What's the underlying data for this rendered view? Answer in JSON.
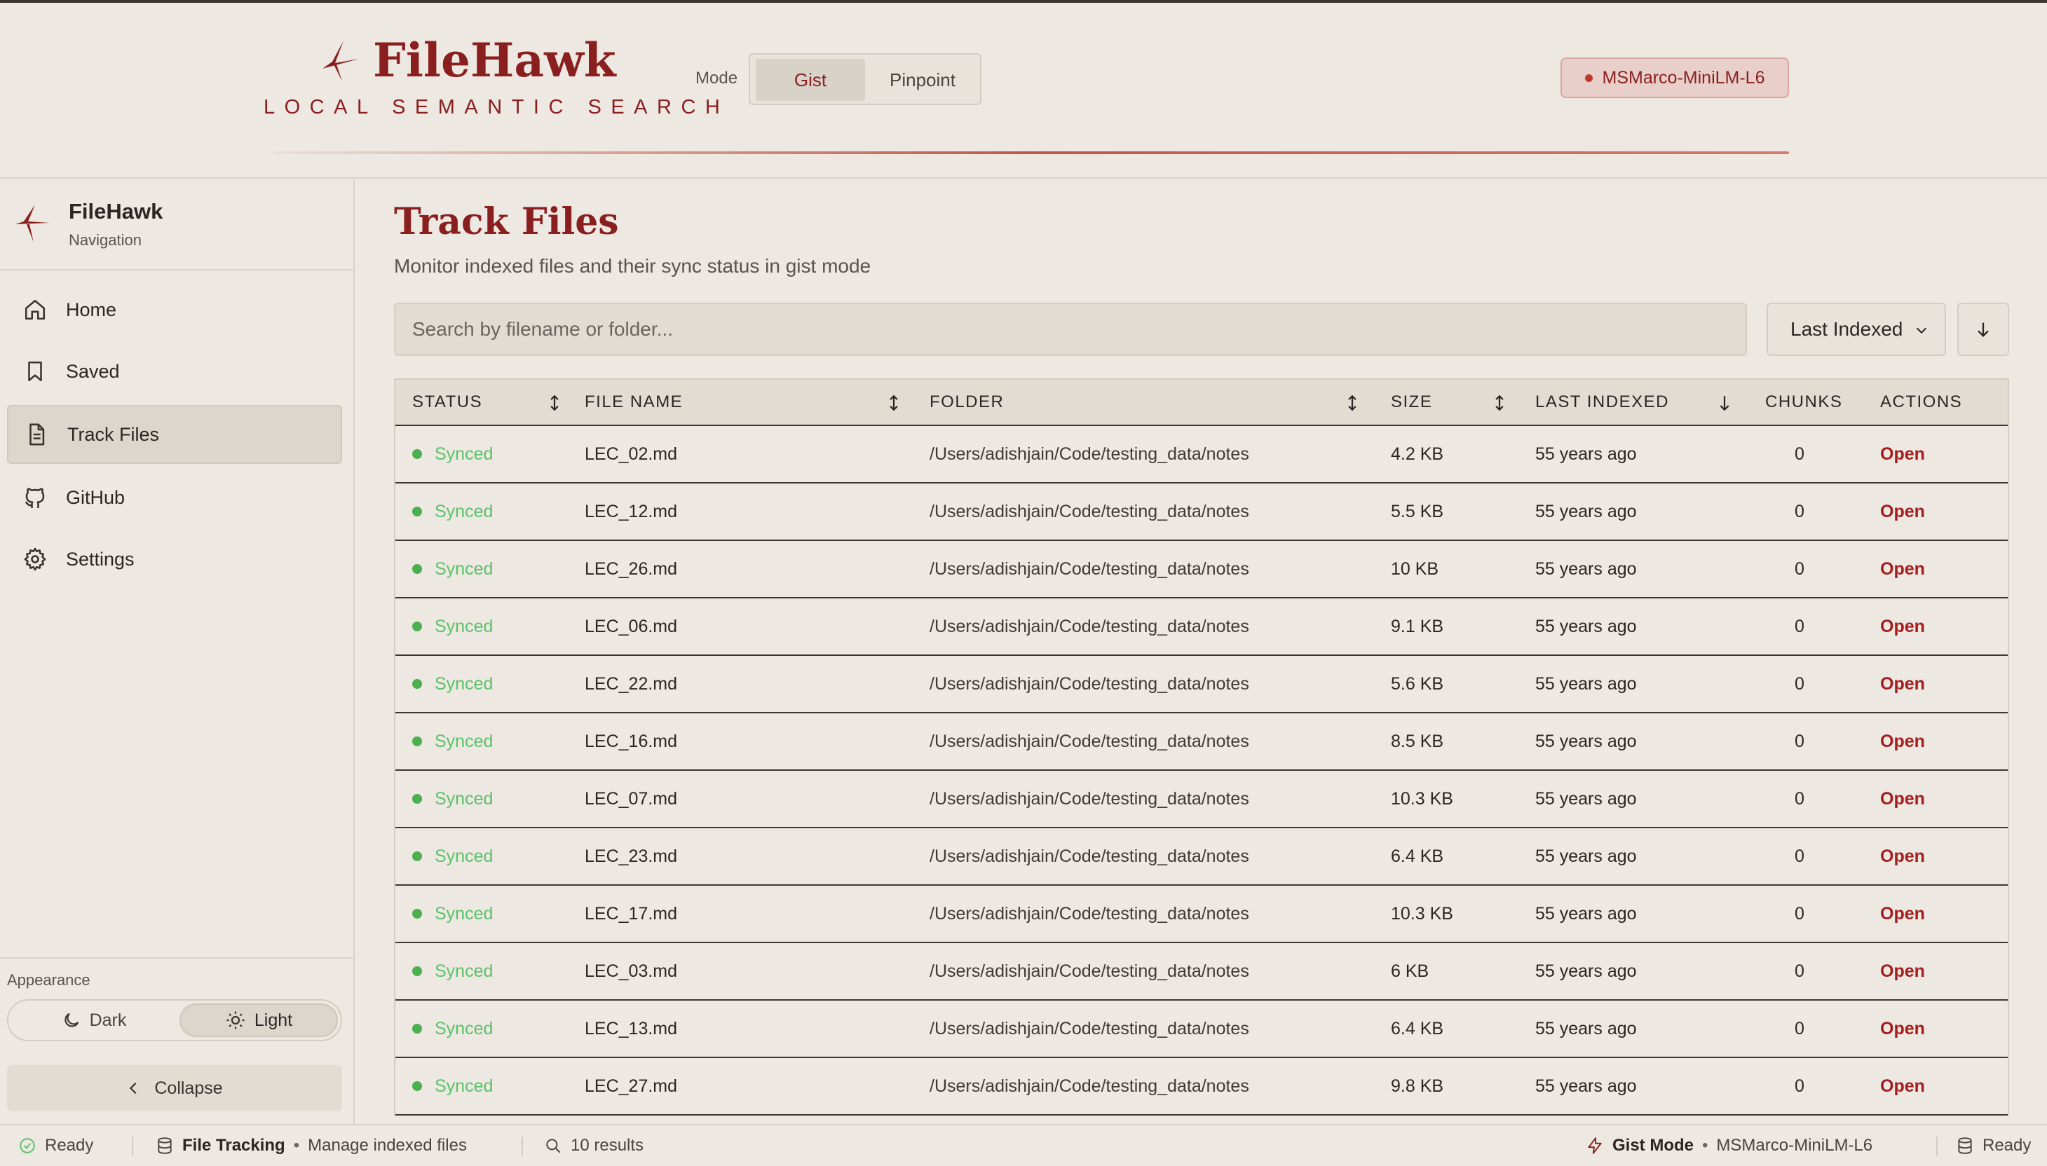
{
  "header": {
    "brand": "FileHawk",
    "tagline": "LOCAL SEMANTIC SEARCH",
    "mode_label": "Mode",
    "modes": [
      "Gist",
      "Pinpoint"
    ],
    "active_mode": "Gist",
    "model_badge": "MSMarco-MiniLM-L6"
  },
  "sidebar": {
    "title": "FileHawk",
    "subtitle": "Navigation",
    "items": [
      {
        "label": "Home",
        "icon": "home-icon"
      },
      {
        "label": "Saved",
        "icon": "bookmark-icon"
      },
      {
        "label": "Track Files",
        "icon": "file-icon",
        "active": true
      },
      {
        "label": "GitHub",
        "icon": "github-icon"
      },
      {
        "label": "Settings",
        "icon": "gear-icon"
      }
    ],
    "appearance_label": "Appearance",
    "theme_dark": "Dark",
    "theme_light": "Light",
    "active_theme": "Light",
    "collapse_label": "Collapse"
  },
  "main": {
    "title": "Track Files",
    "subtitle": "Monitor indexed files and their sync status in gist mode",
    "search_placeholder": "Search by filename or folder...",
    "sort_value": "Last Indexed",
    "sort_direction": "descending",
    "columns": [
      "STATUS",
      "FILE NAME",
      "FOLDER",
      "SIZE",
      "LAST INDEXED",
      "CHUNKS",
      "ACTIONS"
    ],
    "rows": [
      {
        "status": "Synced",
        "file": "LEC_02.md",
        "folder": "/Users/adishjain/Code/testing_data/notes",
        "size": "4.2 KB",
        "indexed": "55 years ago",
        "chunks": "0",
        "action": "Open"
      },
      {
        "status": "Synced",
        "file": "LEC_12.md",
        "folder": "/Users/adishjain/Code/testing_data/notes",
        "size": "5.5 KB",
        "indexed": "55 years ago",
        "chunks": "0",
        "action": "Open"
      },
      {
        "status": "Synced",
        "file": "LEC_26.md",
        "folder": "/Users/adishjain/Code/testing_data/notes",
        "size": "10 KB",
        "indexed": "55 years ago",
        "chunks": "0",
        "action": "Open"
      },
      {
        "status": "Synced",
        "file": "LEC_06.md",
        "folder": "/Users/adishjain/Code/testing_data/notes",
        "size": "9.1 KB",
        "indexed": "55 years ago",
        "chunks": "0",
        "action": "Open"
      },
      {
        "status": "Synced",
        "file": "LEC_22.md",
        "folder": "/Users/adishjain/Code/testing_data/notes",
        "size": "5.6 KB",
        "indexed": "55 years ago",
        "chunks": "0",
        "action": "Open"
      },
      {
        "status": "Synced",
        "file": "LEC_16.md",
        "folder": "/Users/adishjain/Code/testing_data/notes",
        "size": "8.5 KB",
        "indexed": "55 years ago",
        "chunks": "0",
        "action": "Open"
      },
      {
        "status": "Synced",
        "file": "LEC_07.md",
        "folder": "/Users/adishjain/Code/testing_data/notes",
        "size": "10.3 KB",
        "indexed": "55 years ago",
        "chunks": "0",
        "action": "Open"
      },
      {
        "status": "Synced",
        "file": "LEC_23.md",
        "folder": "/Users/adishjain/Code/testing_data/notes",
        "size": "6.4 KB",
        "indexed": "55 years ago",
        "chunks": "0",
        "action": "Open"
      },
      {
        "status": "Synced",
        "file": "LEC_17.md",
        "folder": "/Users/adishjain/Code/testing_data/notes",
        "size": "10.3 KB",
        "indexed": "55 years ago",
        "chunks": "0",
        "action": "Open"
      },
      {
        "status": "Synced",
        "file": "LEC_03.md",
        "folder": "/Users/adishjain/Code/testing_data/notes",
        "size": "6 KB",
        "indexed": "55 years ago",
        "chunks": "0",
        "action": "Open"
      },
      {
        "status": "Synced",
        "file": "LEC_13.md",
        "folder": "/Users/adishjain/Code/testing_data/notes",
        "size": "6.4 KB",
        "indexed": "55 years ago",
        "chunks": "0",
        "action": "Open"
      },
      {
        "status": "Synced",
        "file": "LEC_27.md",
        "folder": "/Users/adishjain/Code/testing_data/notes",
        "size": "9.8 KB",
        "indexed": "55 years ago",
        "chunks": "0",
        "action": "Open"
      }
    ]
  },
  "statusbar": {
    "ready_left": "Ready",
    "section": "File Tracking",
    "section_desc": "Manage indexed files",
    "results": "10 results",
    "mode": "Gist Mode",
    "model": "MSMarco-MiniLM-L6",
    "ready_right": "Ready",
    "separator": "•"
  },
  "colors": {
    "accent": "#8a1f1f",
    "background": "#ede8e1",
    "synced": "#5cc26a",
    "open_link": "#a41e1e"
  }
}
